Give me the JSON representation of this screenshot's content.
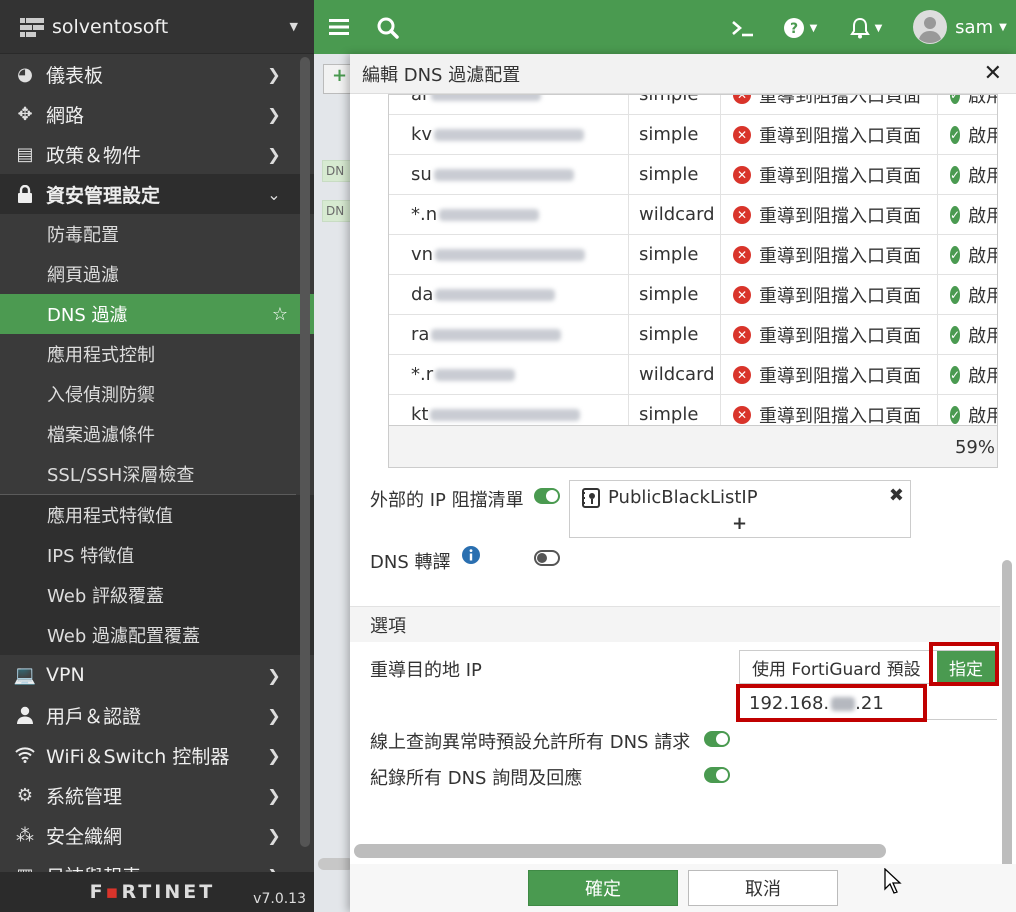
{
  "sidebar": {
    "org_name": "solventosoft",
    "items": [
      {
        "label": "儀表板",
        "icon": "dashboard-icon"
      },
      {
        "label": "網路",
        "icon": "network-icon"
      },
      {
        "label": "政策＆物件",
        "icon": "policy-icon"
      },
      {
        "label": "資安管理設定",
        "icon": "lock-icon"
      }
    ],
    "security_sub": [
      "防毒配置",
      "網頁過濾",
      "DNS 過濾",
      "應用程式控制",
      "入侵偵測防禦",
      "檔案過濾條件",
      "SSL/SSH深層檢查"
    ],
    "security_sub2": [
      "應用程式特徵值",
      "IPS 特徵值",
      "Web 評級覆蓋",
      "Web 過濾配置覆蓋"
    ],
    "items_after": [
      {
        "label": "VPN",
        "icon": "laptop-icon"
      },
      {
        "label": "用戶＆認證",
        "icon": "user-icon"
      },
      {
        "label": "WiFi＆Switch 控制器",
        "icon": "wifi-icon"
      },
      {
        "label": "系統管理",
        "icon": "gear-icon"
      },
      {
        "label": "安全織網",
        "icon": "fabric-icon"
      },
      {
        "label": "日誌與報表",
        "icon": "chart-icon"
      }
    ],
    "footer_brand": "F𝐎RTINET",
    "version": "v7.0.13"
  },
  "topbar": {
    "username": "sam"
  },
  "background": {
    "badge1": "DN",
    "badge2": "DN",
    "add_label": "+"
  },
  "dialog": {
    "title": "編輯 DNS 過濾配置",
    "table": {
      "rows": [
        {
          "domain_prefix": "ar",
          "type": "simple",
          "action": "重導到阻擋入口頁面",
          "status": "啟用"
        },
        {
          "domain_prefix": "kv",
          "type": "simple",
          "action": "重導到阻擋入口頁面",
          "status": "啟用"
        },
        {
          "domain_prefix": "su",
          "type": "simple",
          "action": "重導到阻擋入口頁面",
          "status": "啟用"
        },
        {
          "domain_prefix": "*.n",
          "type": "wildcard",
          "action": "重導到阻擋入口頁面",
          "status": "啟用"
        },
        {
          "domain_prefix": "vn",
          "type": "simple",
          "action": "重導到阻擋入口頁面",
          "status": "啟用"
        },
        {
          "domain_prefix": "da",
          "type": "simple",
          "action": "重導到阻擋入口頁面",
          "status": "啟用"
        },
        {
          "domain_prefix": "ra",
          "type": "simple",
          "action": "重導到阻擋入口頁面",
          "status": "啟用"
        },
        {
          "domain_prefix": "*.r",
          "type": "wildcard",
          "action": "重導到阻擋入口頁面",
          "status": "啟用"
        },
        {
          "domain_prefix": "kt",
          "type": "simple",
          "action": "重導到阻擋入口頁面",
          "status": "啟用"
        }
      ],
      "footer_percent": "59%"
    },
    "external_ip_label": "外部的 IP 阻擋清單",
    "external_ip_entry": "PublicBlackListIP",
    "dns_translation_label": "DNS 轉譯",
    "options_section": "選項",
    "redirect_ip_label": "重導目的地 IP",
    "redirect_opt1": "使用 FortiGuard 預設",
    "redirect_opt2": "指定",
    "redirect_ip_value": "192.168.",
    "redirect_ip_suffix": ".21",
    "allow_dns_label": "線上查詢異常時預設允許所有 DNS 請求",
    "log_dns_label": "紀錄所有 DNS 詢問及回應",
    "ok_label": "確定",
    "cancel_label": "取消"
  },
  "colors": {
    "accent": "#4a9a50",
    "sidebar": "#3a3a3a",
    "highlight": "#c00000"
  }
}
